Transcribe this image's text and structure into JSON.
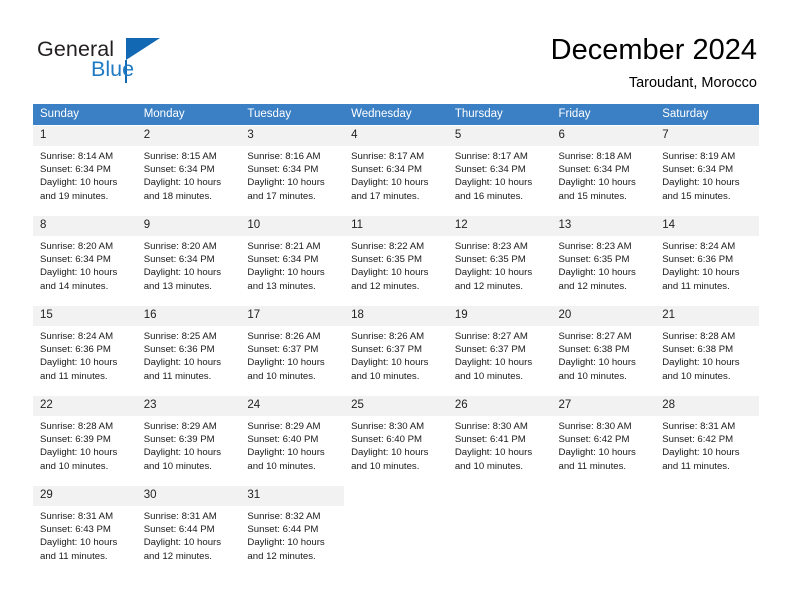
{
  "brand": {
    "name_top": "General",
    "name_bottom": "Blue",
    "triangle_color": "#1268b3",
    "text_color": "#231f20",
    "blue_color": "#1f7ac4"
  },
  "header": {
    "title": "December 2024",
    "subtitle": "Taroudant, Morocco"
  },
  "theme": {
    "header_row_bg": "#3b7fc4",
    "header_row_text": "#ffffff",
    "daynum_bg": "#f2f2f2",
    "cell_text": "#1a1a1a"
  },
  "labels": {
    "sunrise_prefix": "Sunrise:",
    "sunset_prefix": "Sunset:",
    "daylight_prefix": "Daylight:"
  },
  "weekdays": [
    "Sunday",
    "Monday",
    "Tuesday",
    "Wednesday",
    "Thursday",
    "Friday",
    "Saturday"
  ],
  "days": [
    {
      "day": "1",
      "sunrise": "Sunrise: 8:14 AM",
      "sunset": "Sunset: 6:34 PM",
      "daylight": "Daylight: 10 hours and 19 minutes."
    },
    {
      "day": "2",
      "sunrise": "Sunrise: 8:15 AM",
      "sunset": "Sunset: 6:34 PM",
      "daylight": "Daylight: 10 hours and 18 minutes."
    },
    {
      "day": "3",
      "sunrise": "Sunrise: 8:16 AM",
      "sunset": "Sunset: 6:34 PM",
      "daylight": "Daylight: 10 hours and 17 minutes."
    },
    {
      "day": "4",
      "sunrise": "Sunrise: 8:17 AM",
      "sunset": "Sunset: 6:34 PM",
      "daylight": "Daylight: 10 hours and 17 minutes."
    },
    {
      "day": "5",
      "sunrise": "Sunrise: 8:17 AM",
      "sunset": "Sunset: 6:34 PM",
      "daylight": "Daylight: 10 hours and 16 minutes."
    },
    {
      "day": "6",
      "sunrise": "Sunrise: 8:18 AM",
      "sunset": "Sunset: 6:34 PM",
      "daylight": "Daylight: 10 hours and 15 minutes."
    },
    {
      "day": "7",
      "sunrise": "Sunrise: 8:19 AM",
      "sunset": "Sunset: 6:34 PM",
      "daylight": "Daylight: 10 hours and 15 minutes."
    },
    {
      "day": "8",
      "sunrise": "Sunrise: 8:20 AM",
      "sunset": "Sunset: 6:34 PM",
      "daylight": "Daylight: 10 hours and 14 minutes."
    },
    {
      "day": "9",
      "sunrise": "Sunrise: 8:20 AM",
      "sunset": "Sunset: 6:34 PM",
      "daylight": "Daylight: 10 hours and 13 minutes."
    },
    {
      "day": "10",
      "sunrise": "Sunrise: 8:21 AM",
      "sunset": "Sunset: 6:34 PM",
      "daylight": "Daylight: 10 hours and 13 minutes."
    },
    {
      "day": "11",
      "sunrise": "Sunrise: 8:22 AM",
      "sunset": "Sunset: 6:35 PM",
      "daylight": "Daylight: 10 hours and 12 minutes."
    },
    {
      "day": "12",
      "sunrise": "Sunrise: 8:23 AM",
      "sunset": "Sunset: 6:35 PM",
      "daylight": "Daylight: 10 hours and 12 minutes."
    },
    {
      "day": "13",
      "sunrise": "Sunrise: 8:23 AM",
      "sunset": "Sunset: 6:35 PM",
      "daylight": "Daylight: 10 hours and 12 minutes."
    },
    {
      "day": "14",
      "sunrise": "Sunrise: 8:24 AM",
      "sunset": "Sunset: 6:36 PM",
      "daylight": "Daylight: 10 hours and 11 minutes."
    },
    {
      "day": "15",
      "sunrise": "Sunrise: 8:24 AM",
      "sunset": "Sunset: 6:36 PM",
      "daylight": "Daylight: 10 hours and 11 minutes."
    },
    {
      "day": "16",
      "sunrise": "Sunrise: 8:25 AM",
      "sunset": "Sunset: 6:36 PM",
      "daylight": "Daylight: 10 hours and 11 minutes."
    },
    {
      "day": "17",
      "sunrise": "Sunrise: 8:26 AM",
      "sunset": "Sunset: 6:37 PM",
      "daylight": "Daylight: 10 hours and 10 minutes."
    },
    {
      "day": "18",
      "sunrise": "Sunrise: 8:26 AM",
      "sunset": "Sunset: 6:37 PM",
      "daylight": "Daylight: 10 hours and 10 minutes."
    },
    {
      "day": "19",
      "sunrise": "Sunrise: 8:27 AM",
      "sunset": "Sunset: 6:37 PM",
      "daylight": "Daylight: 10 hours and 10 minutes."
    },
    {
      "day": "20",
      "sunrise": "Sunrise: 8:27 AM",
      "sunset": "Sunset: 6:38 PM",
      "daylight": "Daylight: 10 hours and 10 minutes."
    },
    {
      "day": "21",
      "sunrise": "Sunrise: 8:28 AM",
      "sunset": "Sunset: 6:38 PM",
      "daylight": "Daylight: 10 hours and 10 minutes."
    },
    {
      "day": "22",
      "sunrise": "Sunrise: 8:28 AM",
      "sunset": "Sunset: 6:39 PM",
      "daylight": "Daylight: 10 hours and 10 minutes."
    },
    {
      "day": "23",
      "sunrise": "Sunrise: 8:29 AM",
      "sunset": "Sunset: 6:39 PM",
      "daylight": "Daylight: 10 hours and 10 minutes."
    },
    {
      "day": "24",
      "sunrise": "Sunrise: 8:29 AM",
      "sunset": "Sunset: 6:40 PM",
      "daylight": "Daylight: 10 hours and 10 minutes."
    },
    {
      "day": "25",
      "sunrise": "Sunrise: 8:30 AM",
      "sunset": "Sunset: 6:40 PM",
      "daylight": "Daylight: 10 hours and 10 minutes."
    },
    {
      "day": "26",
      "sunrise": "Sunrise: 8:30 AM",
      "sunset": "Sunset: 6:41 PM",
      "daylight": "Daylight: 10 hours and 10 minutes."
    },
    {
      "day": "27",
      "sunrise": "Sunrise: 8:30 AM",
      "sunset": "Sunset: 6:42 PM",
      "daylight": "Daylight: 10 hours and 11 minutes."
    },
    {
      "day": "28",
      "sunrise": "Sunrise: 8:31 AM",
      "sunset": "Sunset: 6:42 PM",
      "daylight": "Daylight: 10 hours and 11 minutes."
    },
    {
      "day": "29",
      "sunrise": "Sunrise: 8:31 AM",
      "sunset": "Sunset: 6:43 PM",
      "daylight": "Daylight: 10 hours and 11 minutes."
    },
    {
      "day": "30",
      "sunrise": "Sunrise: 8:31 AM",
      "sunset": "Sunset: 6:44 PM",
      "daylight": "Daylight: 10 hours and 12 minutes."
    },
    {
      "day": "31",
      "sunrise": "Sunrise: 8:32 AM",
      "sunset": "Sunset: 6:44 PM",
      "daylight": "Daylight: 10 hours and 12 minutes."
    }
  ]
}
